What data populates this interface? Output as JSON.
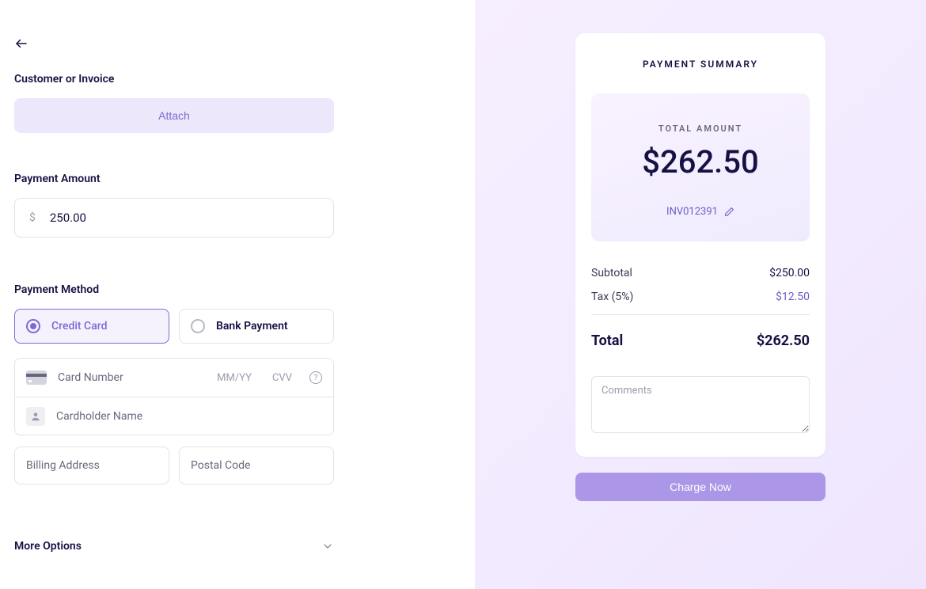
{
  "form": {
    "customer_label": "Customer or Invoice",
    "attach_label": "Attach",
    "amount_label": "Payment Amount",
    "amount_value": "250.00",
    "method_label": "Payment Method",
    "method_credit": "Credit Card",
    "method_bank": "Bank Payment",
    "card_number_placeholder": "Card Number",
    "card_exp_placeholder": "MM/YY",
    "card_cvv_placeholder": "CVV",
    "cardholder_placeholder": "Cardholder Name",
    "billing_placeholder": "Billing Address",
    "postal_placeholder": "Postal Code",
    "more_options_label": "More Options"
  },
  "summary": {
    "heading": "PAYMENT SUMMARY",
    "total_label": "TOTAL AMOUNT",
    "total_amount": "$262.50",
    "invoice_ref": "INV012391",
    "subtotal_label": "Subtotal",
    "subtotal_value": "$250.00",
    "tax_label": "Tax (5%)",
    "tax_value": "$12.50",
    "total_line_label": "Total",
    "total_line_value": "$262.50",
    "comments_placeholder": "Comments",
    "charge_label": "Charge Now"
  }
}
